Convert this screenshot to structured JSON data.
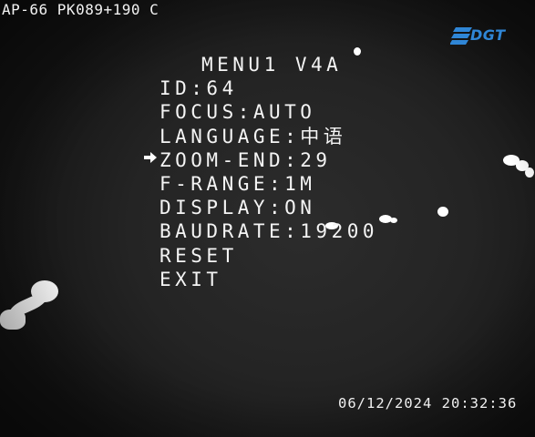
{
  "overlay": {
    "camera_id": "AP-66 PK089+190 C",
    "logo_text": "DGT",
    "timestamp": "06/12/2024 20:32:36"
  },
  "menu": {
    "title": "MENU1 V4A",
    "items": [
      {
        "label": "ID:64"
      },
      {
        "label": "FOCUS:AUTO"
      },
      {
        "label": "LANGUAGE:中语"
      },
      {
        "label": "ZOOM-END:29"
      },
      {
        "label": "F-RANGE:1M"
      },
      {
        "label": "DISPLAY:ON"
      },
      {
        "label": "BAUDRATE:19200"
      },
      {
        "label": "RESET"
      },
      {
        "label": "EXIT"
      }
    ],
    "selected_index": 3,
    "cursor_icon": "arrow-right-icon"
  },
  "colors": {
    "logo": "#2f86d6",
    "text": "#f4f4f4",
    "background": "#242424"
  }
}
